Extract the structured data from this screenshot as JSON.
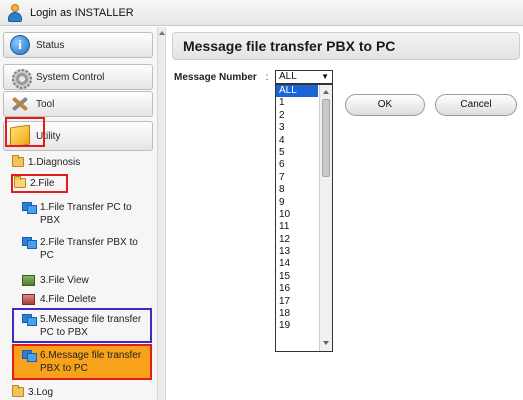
{
  "topbar": {
    "login_text": "Login as INSTALLER"
  },
  "sidebar": {
    "menu": [
      {
        "label": "Status"
      },
      {
        "label": "System Control"
      },
      {
        "label": "Tool"
      },
      {
        "label": "Utility"
      }
    ],
    "tree": {
      "diagnosis": "1.Diagnosis",
      "file": "2.File",
      "items": [
        "1.File Transfer PC to PBX",
        "2.File Transfer PBX to PC",
        "3.File View",
        "4.File Delete",
        "5.Message file transfer PC to PBX",
        "6.Message file transfer PBX to PC"
      ],
      "log": "3.Log"
    }
  },
  "main": {
    "title": "Message file transfer PBX to PC",
    "field_label": "Message Number",
    "field_sep": ":",
    "selected_value": "ALL",
    "options": [
      "ALL",
      "1",
      "2",
      "3",
      "4",
      "5",
      "6",
      "7",
      "8",
      "9",
      "10",
      "11",
      "12",
      "13",
      "14",
      "15",
      "16",
      "17",
      "18",
      "19"
    ],
    "ok_label": "OK",
    "cancel_label": "Cancel"
  },
  "colors": {
    "highlight_red": "#e21b1b",
    "highlight_blue": "#3a2cc6",
    "selected_item_bg": "#f8a21c",
    "dropdown_selected": "#1a64d6"
  }
}
